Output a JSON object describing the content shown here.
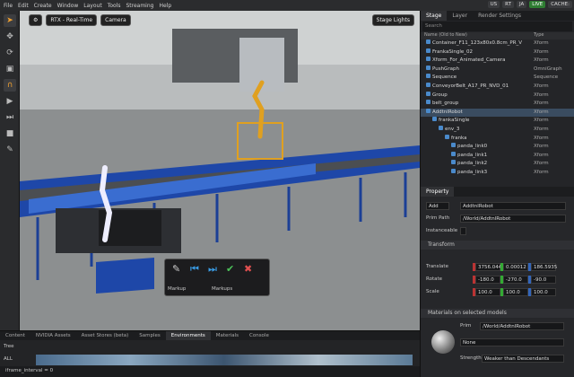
{
  "menu": [
    "File",
    "Edit",
    "Create",
    "Window",
    "Layout",
    "Tools",
    "Streaming",
    "Help"
  ],
  "status_chips": {
    "us": "US",
    "rt": "RT",
    "ja": "JA",
    "live": "LIVE",
    "cache": "CACHE:"
  },
  "viewport": {
    "rtx_mode": "RTX - Real-Time",
    "camera": "Camera",
    "stage_lights": "Stage Lights",
    "markup_label_left": "Markup",
    "markup_label_right": "Markups"
  },
  "right_tabs": [
    "Stage",
    "Layer",
    "Render Settings"
  ],
  "search_placeholder": "Search",
  "tree_headers": {
    "name": "Name (Old to New)",
    "type": "Type"
  },
  "tree": [
    {
      "name": "Container_F11_123x80x0.8cm_PR_V",
      "type": "Xform",
      "d": 0
    },
    {
      "name": "FrankaSingle_02",
      "type": "Xform",
      "d": 0
    },
    {
      "name": "Xform_For_Animated_Camera",
      "type": "Xform",
      "d": 0
    },
    {
      "name": "PushGraph",
      "type": "OmniGraph",
      "d": 0
    },
    {
      "name": "Sequence",
      "type": "Sequence",
      "d": 0
    },
    {
      "name": "ConveyorBelt_A17_PR_NVD_01",
      "type": "Xform",
      "d": 0
    },
    {
      "name": "Group",
      "type": "Xform",
      "d": 0
    },
    {
      "name": "belt_group",
      "type": "Xform",
      "d": 0
    },
    {
      "name": "AddtnlRobot",
      "type": "Xform",
      "d": 0,
      "sel": true
    },
    {
      "name": "frankaSingle",
      "type": "Xform",
      "d": 1
    },
    {
      "name": "env_3",
      "type": "Xform",
      "d": 2
    },
    {
      "name": "franka",
      "type": "Xform",
      "d": 3
    },
    {
      "name": "panda_link0",
      "type": "Xform",
      "d": 4
    },
    {
      "name": "panda_link1",
      "type": "Xform",
      "d": 4
    },
    {
      "name": "panda_link2",
      "type": "Xform",
      "d": 4
    },
    {
      "name": "panda_link3",
      "type": "Xform",
      "d": 4
    }
  ],
  "property": {
    "tab": "Property",
    "add": "Add",
    "add_value": "AddtnlRobot",
    "prim_path_label": "Prim Path",
    "prim_path": "/World/AddtnlRobot",
    "instanceable_label": "Instanceable",
    "transform": "Transform",
    "translate_label": "Translate",
    "translate": [
      "3756.044",
      "0.00012",
      "186.5935"
    ],
    "rotate_label": "Rotate",
    "rotate": [
      "-180.0",
      "-270.0",
      "-90.0"
    ],
    "scale_label": "Scale",
    "scale": [
      "100.0",
      "100.0",
      "100.0"
    ],
    "materials": "Materials on selected models",
    "prim_label": "Prim",
    "prim": "/World/AddtnlRobot",
    "material_value": "None",
    "strength_label": "Strength",
    "strength_value": "Weaker than Descendants"
  },
  "bottom_tabs": [
    "Content",
    "NVIDIA Assets",
    "Asset Stores (beta)",
    "Samples",
    "Environments",
    "Materials",
    "Console"
  ],
  "bottom_tree": "Tree",
  "bottom_all": "ALL",
  "status": "iframe_interval = 0"
}
